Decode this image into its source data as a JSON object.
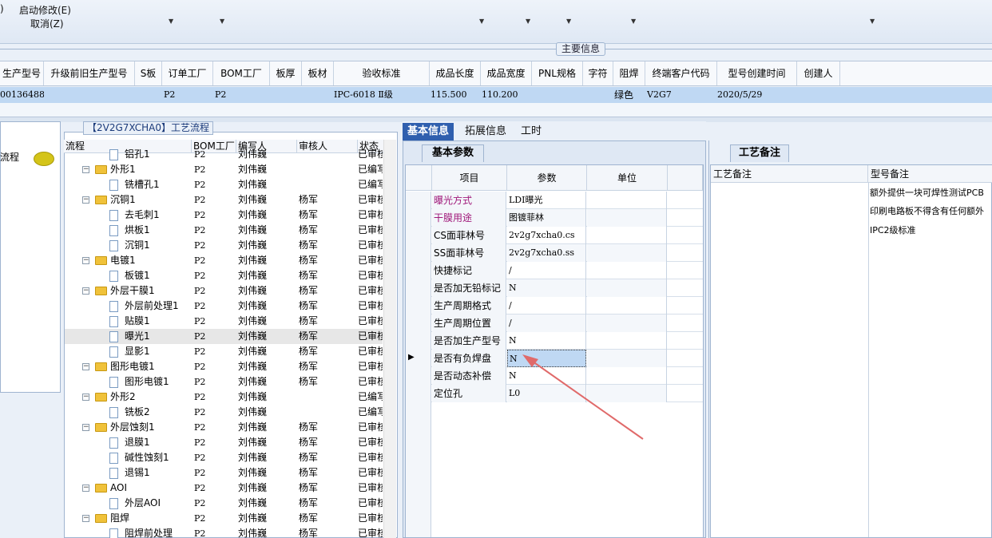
{
  "toolbar": {
    "items": [
      {
        "label": ")",
        "x": 0
      },
      {
        "label": "启动修改(E)",
        "x": 24
      },
      {
        "label": "取消(Z)",
        "x": 38
      }
    ]
  },
  "main_info": {
    "label": "主要信息",
    "headers": [
      "生产型号",
      "升级前旧生产型号",
      "S板",
      "订单工厂",
      "BOM工厂",
      "板厚",
      "板材",
      "验收标准",
      "成品长度",
      "成品宽度",
      "PNL规格",
      "字符",
      "阻焊",
      "终端客户代码",
      "型号创建时间",
      "创建人"
    ],
    "row": [
      "00136488",
      "",
      "",
      "P2",
      "P2",
      "",
      "",
      "IPC-6018 Ⅱ级",
      "115.500",
      "110.200",
      "",
      "",
      "绿色",
      "V2G7",
      "2020/5/29",
      ""
    ]
  },
  "left_pane": {
    "title": "流程"
  },
  "flow": {
    "tag": "【2V2G7XCHA0】工艺流程",
    "headers": [
      "流程",
      "BOM工厂",
      "编写人",
      "审核人",
      "状态"
    ],
    "rows": [
      {
        "name": "铝孔1",
        "level": 2,
        "bom": "P2",
        "writer": "刘伟巍",
        "reviewer": "",
        "status": "已审核"
      },
      {
        "name": "外形1",
        "level": 1,
        "bom": "P2",
        "writer": "刘伟巍",
        "reviewer": "",
        "status": "已编写"
      },
      {
        "name": "铣槽孔1",
        "level": 2,
        "bom": "P2",
        "writer": "刘伟巍",
        "reviewer": "",
        "status": "已编写"
      },
      {
        "name": "沉铜1",
        "level": 1,
        "bom": "P2",
        "writer": "刘伟巍",
        "reviewer": "杨军",
        "status": "已审核"
      },
      {
        "name": "去毛刺1",
        "level": 2,
        "bom": "P2",
        "writer": "刘伟巍",
        "reviewer": "杨军",
        "status": "已审核"
      },
      {
        "name": "烘板1",
        "level": 2,
        "bom": "P2",
        "writer": "刘伟巍",
        "reviewer": "杨军",
        "status": "已审核"
      },
      {
        "name": "沉铜1",
        "level": 2,
        "bom": "P2",
        "writer": "刘伟巍",
        "reviewer": "杨军",
        "status": "已审核"
      },
      {
        "name": "电镀1",
        "level": 1,
        "bom": "P2",
        "writer": "刘伟巍",
        "reviewer": "杨军",
        "status": "已审核"
      },
      {
        "name": "板镀1",
        "level": 2,
        "bom": "P2",
        "writer": "刘伟巍",
        "reviewer": "杨军",
        "status": "已审核"
      },
      {
        "name": "外层干膜1",
        "level": 1,
        "bom": "P2",
        "writer": "刘伟巍",
        "reviewer": "杨军",
        "status": "已审核"
      },
      {
        "name": "外层前处理1",
        "level": 2,
        "bom": "P2",
        "writer": "刘伟巍",
        "reviewer": "杨军",
        "status": "已审核"
      },
      {
        "name": "贴膜1",
        "level": 2,
        "bom": "P2",
        "writer": "刘伟巍",
        "reviewer": "杨军",
        "status": "已审核"
      },
      {
        "name": "曝光1",
        "level": 2,
        "bom": "P2",
        "writer": "刘伟巍",
        "reviewer": "杨军",
        "status": "已审核",
        "selected": true
      },
      {
        "name": "显影1",
        "level": 2,
        "bom": "P2",
        "writer": "刘伟巍",
        "reviewer": "杨军",
        "status": "已审核"
      },
      {
        "name": "图形电镀1",
        "level": 1,
        "bom": "P2",
        "writer": "刘伟巍",
        "reviewer": "杨军",
        "status": "已审核"
      },
      {
        "name": "图形电镀1",
        "level": 2,
        "bom": "P2",
        "writer": "刘伟巍",
        "reviewer": "杨军",
        "status": "已审核"
      },
      {
        "name": "外形2",
        "level": 1,
        "bom": "P2",
        "writer": "刘伟巍",
        "reviewer": "",
        "status": "已编写"
      },
      {
        "name": "铣板2",
        "level": 2,
        "bom": "P2",
        "writer": "刘伟巍",
        "reviewer": "",
        "status": "已编写"
      },
      {
        "name": "外层蚀刻1",
        "level": 1,
        "bom": "P2",
        "writer": "刘伟巍",
        "reviewer": "杨军",
        "status": "已审核"
      },
      {
        "name": "退膜1",
        "level": 2,
        "bom": "P2",
        "writer": "刘伟巍",
        "reviewer": "杨军",
        "status": "已审核"
      },
      {
        "name": "碱性蚀刻1",
        "level": 2,
        "bom": "P2",
        "writer": "刘伟巍",
        "reviewer": "杨军",
        "status": "已审核"
      },
      {
        "name": "退锡1",
        "level": 2,
        "bom": "P2",
        "writer": "刘伟巍",
        "reviewer": "杨军",
        "status": "已审核"
      },
      {
        "name": "AOI",
        "level": 1,
        "bom": "P2",
        "writer": "刘伟巍",
        "reviewer": "杨军",
        "status": "已审核"
      },
      {
        "name": "外层AOI",
        "level": 2,
        "bom": "P2",
        "writer": "刘伟巍",
        "reviewer": "杨军",
        "status": "已审核"
      },
      {
        "name": "阻焊",
        "level": 1,
        "bom": "P2",
        "writer": "刘伟巍",
        "reviewer": "杨军",
        "status": "已审核"
      },
      {
        "name": "阻焊前处理",
        "level": 2,
        "bom": "P2",
        "writer": "刘伟巍",
        "reviewer": "杨军",
        "status": "已审核"
      }
    ]
  },
  "mid": {
    "tabs": [
      "基本信息",
      "拓展信息",
      "工时"
    ],
    "section": "基本参数",
    "headers": [
      "项目",
      "参数",
      "单位"
    ],
    "rows": [
      {
        "item": "曝光方式",
        "param": "LDI曝光",
        "unit": "",
        "highlight": true
      },
      {
        "item": "干膜用途",
        "param": "图镀菲林",
        "unit": "",
        "highlight": true
      },
      {
        "item": "CS面菲林号",
        "param": "2v2g7xcha0.cs",
        "unit": ""
      },
      {
        "item": "SS面菲林号",
        "param": "2v2g7xcha0.ss",
        "unit": ""
      },
      {
        "item": "快捷标记",
        "param": "/",
        "unit": ""
      },
      {
        "item": "是否加无铅标记",
        "param": "N",
        "unit": ""
      },
      {
        "item": "生产周期格式",
        "param": "/",
        "unit": ""
      },
      {
        "item": "生产周期位置",
        "param": "/",
        "unit": ""
      },
      {
        "item": "是否加生产型号",
        "param": "N",
        "unit": ""
      },
      {
        "item": "是否有负焊盘",
        "param": "N",
        "unit": "",
        "current": true
      },
      {
        "item": "是否动态补偿",
        "param": "N",
        "unit": ""
      },
      {
        "item": "定位孔",
        "param": "L0",
        "unit": ""
      }
    ]
  },
  "right": {
    "section": "工艺备注",
    "headers": [
      "工艺备注",
      "型号备注"
    ],
    "notes": [
      "额外提供一块可焊性测试PCB",
      "印刷电路板不得含有任何额外",
      "IPC2级标准"
    ]
  },
  "colors": {
    "highlight_text": "#a0187a",
    "tab_active": "#2f5fae",
    "row_selected": "#bfd8f3",
    "arrow": "#e06a6a"
  }
}
